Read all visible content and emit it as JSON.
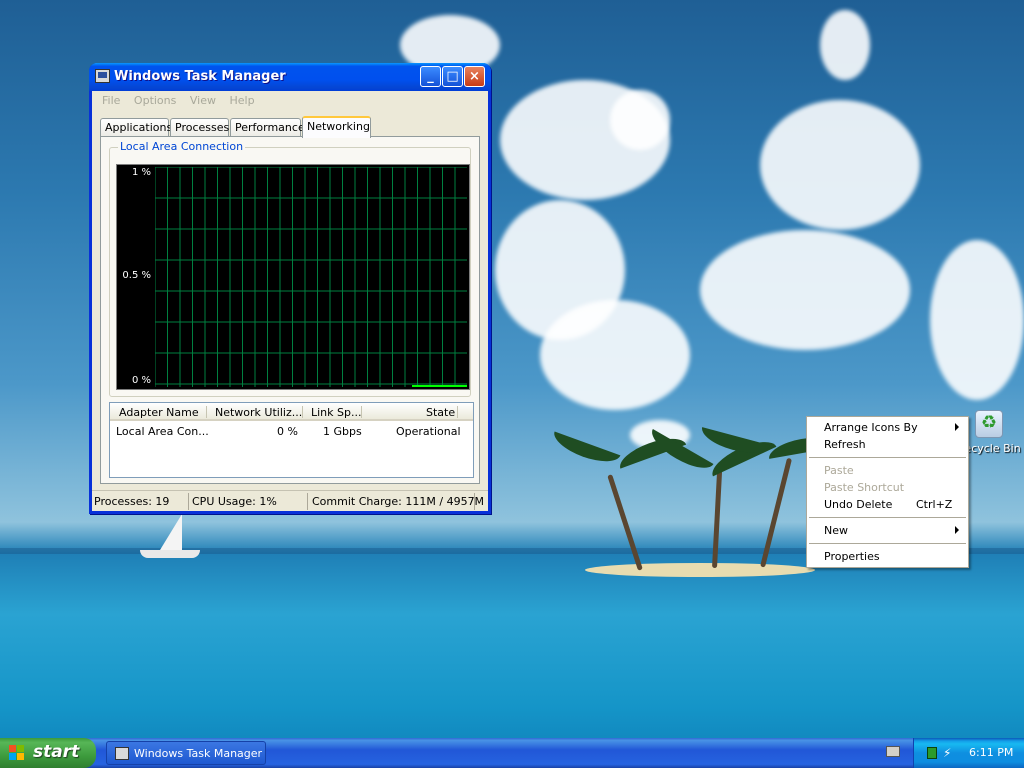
{
  "desktop": {
    "recycle_bin_label": "Recycle Bin"
  },
  "task_manager": {
    "title": "Windows Task Manager",
    "controls": {
      "minimize": "_",
      "maximize": "□",
      "close": "×"
    },
    "menu": [
      "File",
      "Options",
      "View",
      "Help"
    ],
    "tabs": [
      "Applications",
      "Processes",
      "Performance",
      "Networking"
    ],
    "active_tab": "Networking",
    "graph": {
      "title": "Local Area Connection",
      "y_labels": [
        "1 %",
        "0.5 %",
        "0 %"
      ],
      "utilization_pct": 0
    },
    "adapter_table": {
      "columns": [
        "Adapter Name",
        "Network Utiliz...",
        "Link Sp...",
        "State"
      ],
      "rows": [
        {
          "adapter": "Local Area Con...",
          "utilization": "0 %",
          "speed": "1 Gbps",
          "state": "Operational"
        }
      ]
    },
    "status": {
      "processes": "Processes: 19",
      "cpu": "CPU Usage: 1%",
      "commit": "Commit Charge: 111M / 4957M"
    }
  },
  "context_menu": {
    "items": [
      {
        "label": "Arrange Icons By",
        "submenu": true
      },
      {
        "label": "Refresh"
      },
      {
        "label": "Paste",
        "disabled": true
      },
      {
        "label": "Paste Shortcut",
        "disabled": true
      },
      {
        "label": "Undo Delete",
        "shortcut": "Ctrl+Z"
      },
      {
        "label": "New",
        "submenu": true
      },
      {
        "label": "Properties"
      }
    ]
  },
  "taskbar": {
    "start_label": "start",
    "tasks": [
      "Windows Task Manager"
    ],
    "clock": "6:11 PM"
  },
  "colors": {
    "title_bar": "#0053ee",
    "graph_background": "#000000",
    "graph_grid": "#008040",
    "graph_trace": "#00ff00",
    "start_button": "#3d9b3d",
    "taskbar": "#2157d7",
    "active_tab_highlight": "#ffc83c",
    "group_title": "#0046d5"
  }
}
